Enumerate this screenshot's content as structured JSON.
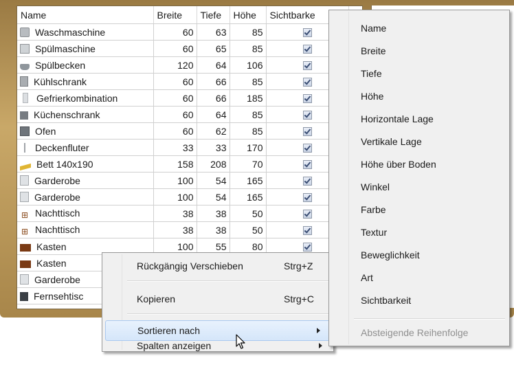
{
  "table": {
    "columns": [
      "Name",
      "Breite",
      "Tiefe",
      "Höhe",
      "Sichtbarke"
    ],
    "rows": [
      {
        "icon": "washing-machine-icon",
        "name": "Waschmaschine",
        "breite": "60",
        "tiefe": "63",
        "hoehe": "85"
      },
      {
        "icon": "dishwasher-icon",
        "name": "Spülmaschine",
        "breite": "60",
        "tiefe": "65",
        "hoehe": "85"
      },
      {
        "icon": "sink-icon",
        "name": "Spülbecken",
        "breite": "120",
        "tiefe": "64",
        "hoehe": "106"
      },
      {
        "icon": "fridge-icon",
        "name": "Kühlschrank",
        "breite": "60",
        "tiefe": "66",
        "hoehe": "85"
      },
      {
        "icon": "freezer-icon",
        "name": "Gefrierkombination",
        "breite": "60",
        "tiefe": "66",
        "hoehe": "185"
      },
      {
        "icon": "kitchen-cabinet-icon",
        "name": "Küchenschrank",
        "breite": "60",
        "tiefe": "64",
        "hoehe": "85"
      },
      {
        "icon": "oven-icon",
        "name": "Ofen",
        "breite": "60",
        "tiefe": "62",
        "hoehe": "85"
      },
      {
        "icon": "floor-lamp-icon",
        "name": "Deckenfluter",
        "breite": "33",
        "tiefe": "33",
        "hoehe": "170"
      },
      {
        "icon": "bed-icon",
        "name": "Bett 140x190",
        "breite": "158",
        "tiefe": "208",
        "hoehe": "70"
      },
      {
        "icon": "wardrobe-icon",
        "name": "Garderobe",
        "breite": "100",
        "tiefe": "54",
        "hoehe": "165"
      },
      {
        "icon": "wardrobe-icon",
        "name": "Garderobe",
        "breite": "100",
        "tiefe": "54",
        "hoehe": "165"
      },
      {
        "icon": "nightstand-icon",
        "name": "Nachttisch",
        "breite": "38",
        "tiefe": "38",
        "hoehe": "50"
      },
      {
        "icon": "nightstand-icon",
        "name": "Nachttisch",
        "breite": "38",
        "tiefe": "38",
        "hoehe": "50"
      },
      {
        "icon": "chest-icon",
        "name": "Kasten",
        "breite": "100",
        "tiefe": "55",
        "hoehe": "80"
      },
      {
        "icon": "chest-icon",
        "name": "Kasten",
        "breite": "",
        "tiefe": "",
        "hoehe": ""
      },
      {
        "icon": "wardrobe-icon",
        "name": "Garderobe",
        "breite": "",
        "tiefe": "",
        "hoehe": ""
      },
      {
        "icon": "tv-cabinet-icon",
        "name": "Fernsehtisc",
        "breite": "",
        "tiefe": "",
        "hoehe": ""
      }
    ]
  },
  "context_menu": {
    "items": [
      {
        "label": "Rückgängig Verschieben",
        "shortcut": "Strg+Z"
      },
      {
        "label": "Kopieren",
        "shortcut": "Strg+C"
      },
      {
        "label": "Sortieren nach",
        "shortcut": ""
      },
      {
        "label": "Spalten anzeigen",
        "shortcut": ""
      }
    ]
  },
  "submenu": {
    "items": [
      "Name",
      "Breite",
      "Tiefe",
      "Höhe",
      "Horizontale Lage",
      "Vertikale Lage",
      "Höhe über Boden",
      "Winkel",
      "Farbe",
      "Textur",
      "Beweglichkeit",
      "Art",
      "Sichtbarkeit"
    ],
    "disabled_item": "Absteigende Reihenfolge"
  }
}
